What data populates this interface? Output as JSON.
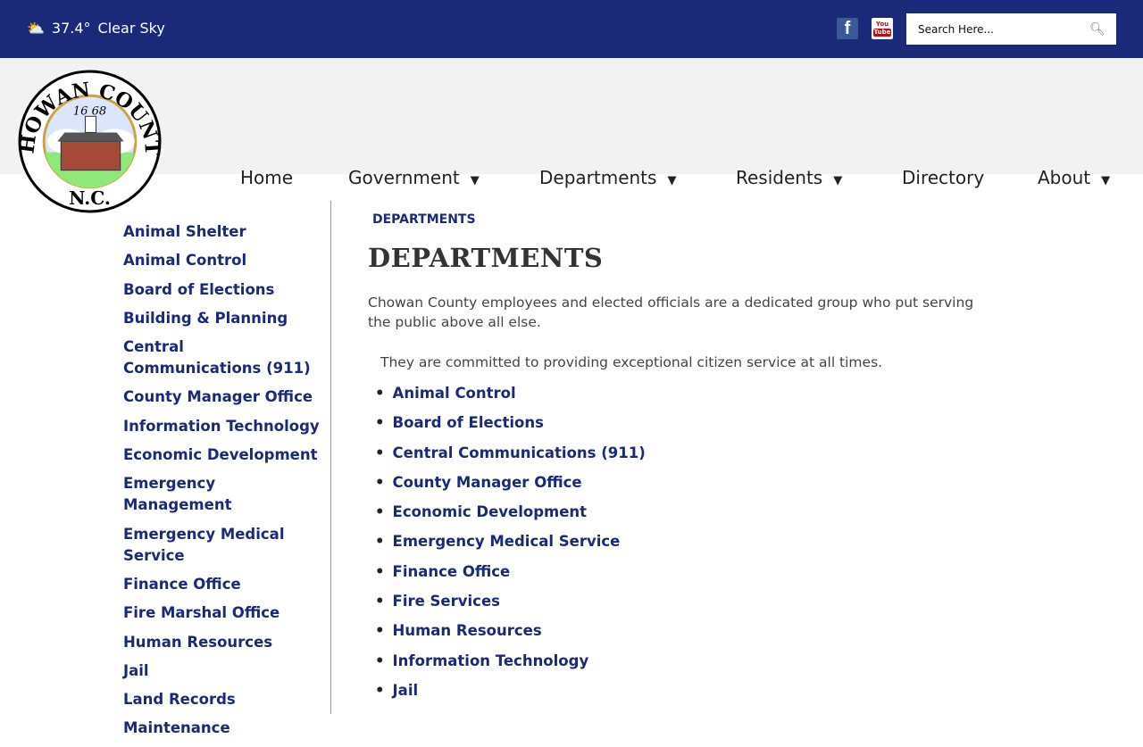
{
  "topbar": {
    "weather_icon": "partly-cloudy-icon",
    "temperature": "37.4°",
    "condition": "Clear Sky",
    "search_placeholder": "Search Here...",
    "social": [
      {
        "name": "facebook",
        "label": "f"
      },
      {
        "name": "youtube",
        "label_top": "You",
        "label_bottom": "Tube"
      }
    ]
  },
  "logo": {
    "text": "CHOWAN COUNTY N.C. 1668"
  },
  "nav": [
    {
      "label": "Home",
      "dropdown": false
    },
    {
      "label": "Government",
      "dropdown": true
    },
    {
      "label": "Departments",
      "dropdown": true
    },
    {
      "label": "Residents",
      "dropdown": true
    },
    {
      "label": "Directory",
      "dropdown": false
    },
    {
      "label": "About",
      "dropdown": true
    }
  ],
  "sidebar": [
    "Animal Shelter",
    "Animal Control",
    "Board of Elections",
    "Building & Planning",
    "Central Communications (911)",
    "County Manager Office",
    "Information Technology",
    "Economic Development",
    "Emergency Management",
    "Emergency Medical Service",
    "Finance Office",
    "Fire Marshal Office",
    "Human Resources",
    "Jail",
    "Land Records",
    "Maintenance"
  ],
  "main": {
    "breadcrumb": "DEPARTMENTS",
    "title": "DEPARTMENTS",
    "intro": "Chowan County employees and elected officials are a dedicated group who put serving the public above all else.",
    "commitment": "They  are committed to providing exceptional citizen service at all times.",
    "departments": [
      "Animal Control",
      "Board of Elections",
      "Central Communications (911)",
      "County Manager Office",
      "Economic Development",
      "Emergency Medical Service",
      "Finance Office",
      "Fire Services",
      "Human Resources",
      "Information Technology",
      "Jail"
    ]
  },
  "colors": {
    "brand": "#1a2a78",
    "nav_bg": "#f2f2f2"
  }
}
